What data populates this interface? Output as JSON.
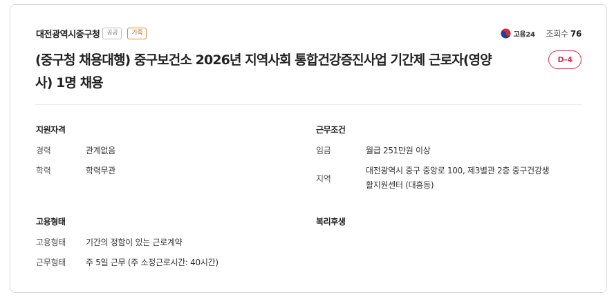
{
  "header": {
    "company": "대전광역시중구청",
    "badges": {
      "public": "공공",
      "family": "가족"
    },
    "source": "고용24",
    "views_label": "조회수",
    "views_count": "76"
  },
  "title": "(중구청 채용대행) 중구보건소 2026년 지역사회 통합건강증진사업 기간제 근로자(영양사) 1명 채용",
  "dday": "D-4",
  "sections": {
    "qualification": {
      "title": "지원자격",
      "career_label": "경력",
      "career_value": "관계없음",
      "education_label": "학력",
      "education_value": "학력무관"
    },
    "conditions": {
      "title": "근무조건",
      "wage_label": "임금",
      "wage_value": "월급 251만원 이상",
      "region_label": "지역",
      "region_line1": "대전광역시 중구 중앙로 100, 제3별관 2층 중구건강생",
      "region_line2": "활지원센터 (대흥동)"
    },
    "employment": {
      "title": "고용형태",
      "type_label": "고용형태",
      "type_value": "기간의 정함이 있는 근로계약",
      "work_label": "근무형태",
      "work_value": "주 5일 근무 (주 소정근로시간: 40시간)"
    },
    "welfare": {
      "title": "복리후생"
    }
  },
  "colors": {
    "accent": "#d8334a",
    "family_badge": "#b8741f"
  },
  "icons": {
    "gov_logo": "korea-taegeuk-icon"
  }
}
